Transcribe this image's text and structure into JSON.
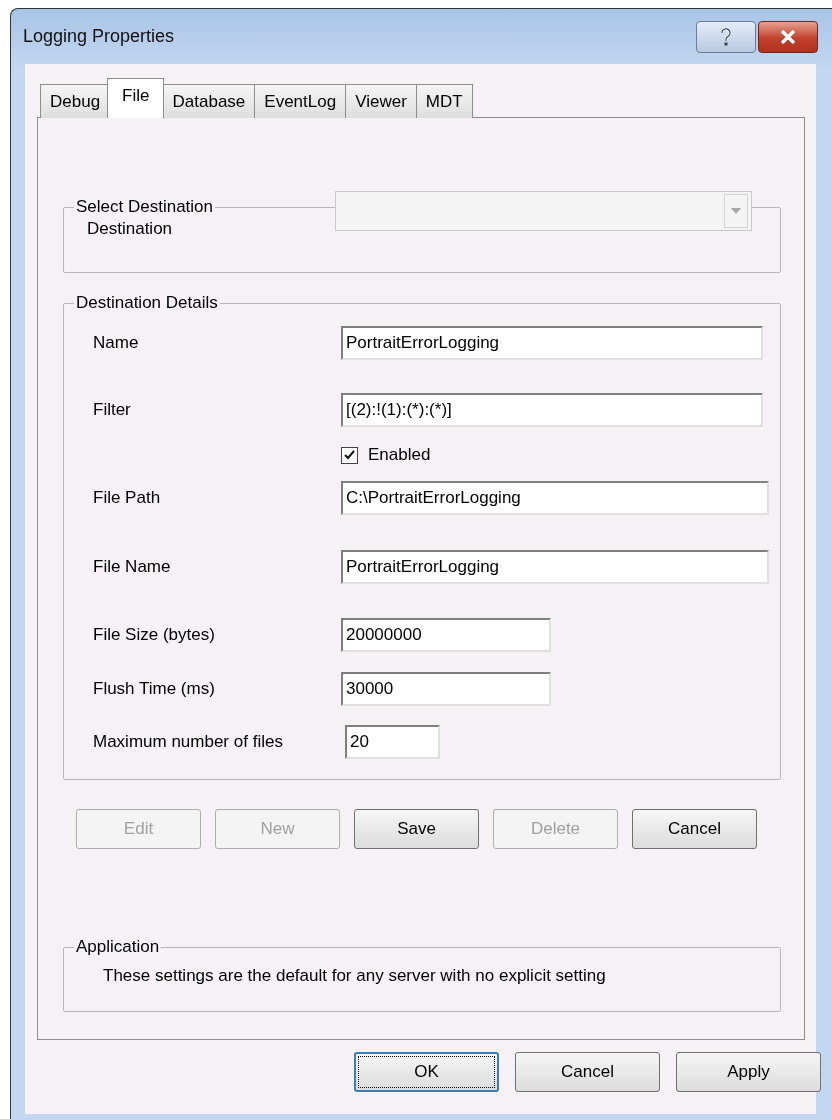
{
  "window": {
    "title": "Logging Properties"
  },
  "tabs": [
    {
      "label": "Debug",
      "selected": false
    },
    {
      "label": "File",
      "selected": true
    },
    {
      "label": "Database",
      "selected": false
    },
    {
      "label": "EventLog",
      "selected": false
    },
    {
      "label": "Viewer",
      "selected": false
    },
    {
      "label": "MDT",
      "selected": false
    }
  ],
  "select_destination": {
    "title": "Select Destination",
    "label": "Destination",
    "disabled": true
  },
  "destination_details": {
    "title": "Destination Details",
    "rows": [
      {
        "kind": "text",
        "label": "Name",
        "value": "PortraitErrorLogging"
      },
      {
        "kind": "text",
        "label": "Filter",
        "value": "[(2):!(1):(*):(*)]"
      },
      {
        "kind": "checkbox",
        "label": "Enabled",
        "checked": true
      },
      {
        "kind": "text",
        "label": "File Path",
        "value": "C:\\PortraitErrorLogging"
      },
      {
        "kind": "text",
        "label": "File Name",
        "value": "PortraitErrorLogging"
      },
      {
        "kind": "text",
        "label": "File Size (bytes)",
        "value": "20000000"
      },
      {
        "kind": "text",
        "label": "Flush Time (ms)",
        "value": "30000"
      },
      {
        "kind": "text",
        "label": "Maximum number of files",
        "value": "20"
      }
    ]
  },
  "destination_buttons": [
    {
      "label": "Edit",
      "disabled": true
    },
    {
      "label": "New",
      "disabled": true
    },
    {
      "label": "Save",
      "disabled": false
    },
    {
      "label": "Delete",
      "disabled": true
    },
    {
      "label": "Cancel",
      "disabled": false
    }
  ],
  "application": {
    "title": "Application",
    "text": "These settings are the default for any server with no explicit setting"
  },
  "dialog_buttons": [
    {
      "label": "OK",
      "focused": true
    },
    {
      "label": "Cancel",
      "focused": false
    },
    {
      "label": "Apply",
      "focused": false
    }
  ]
}
